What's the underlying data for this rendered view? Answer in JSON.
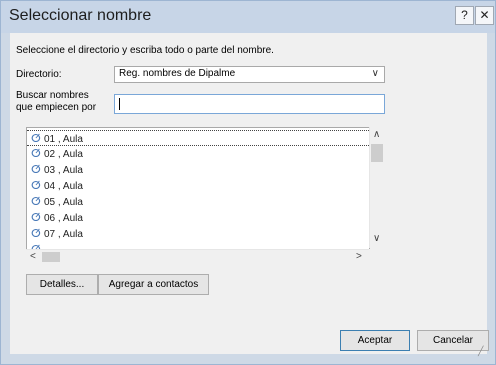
{
  "window": {
    "title": "Seleccionar nombre",
    "help_label": "?",
    "close_label": "✕"
  },
  "instructions": "Seleccione el directorio y escriba todo o parte del nombre.",
  "directory": {
    "label": "Directorio:",
    "value": "Reg. nombres de Dipalme"
  },
  "search": {
    "label_line1": "Buscar nombres",
    "label_line2": "que empiecen por",
    "value": ""
  },
  "list": {
    "items": [
      {
        "name": "01 , Aula"
      },
      {
        "name": "02 , Aula"
      },
      {
        "name": "03 , Aula"
      },
      {
        "name": "04 , Aula"
      },
      {
        "name": "05 , Aula"
      },
      {
        "name": "06 , Aula"
      },
      {
        "name": "07 , Aula"
      }
    ],
    "selected_index": 0
  },
  "buttons": {
    "details": "Detalles...",
    "add_contacts": "Agregar a contactos",
    "accept": "Aceptar",
    "cancel": "Cancelar"
  },
  "icons": {
    "contact": "person-icon",
    "help": "help-icon",
    "close": "close-icon"
  },
  "colors": {
    "titlebar": "#c7d5e7",
    "client": "#f0f0f0",
    "contact_icon": "#4a7ab8",
    "focus_border": "#7aa7d8"
  }
}
